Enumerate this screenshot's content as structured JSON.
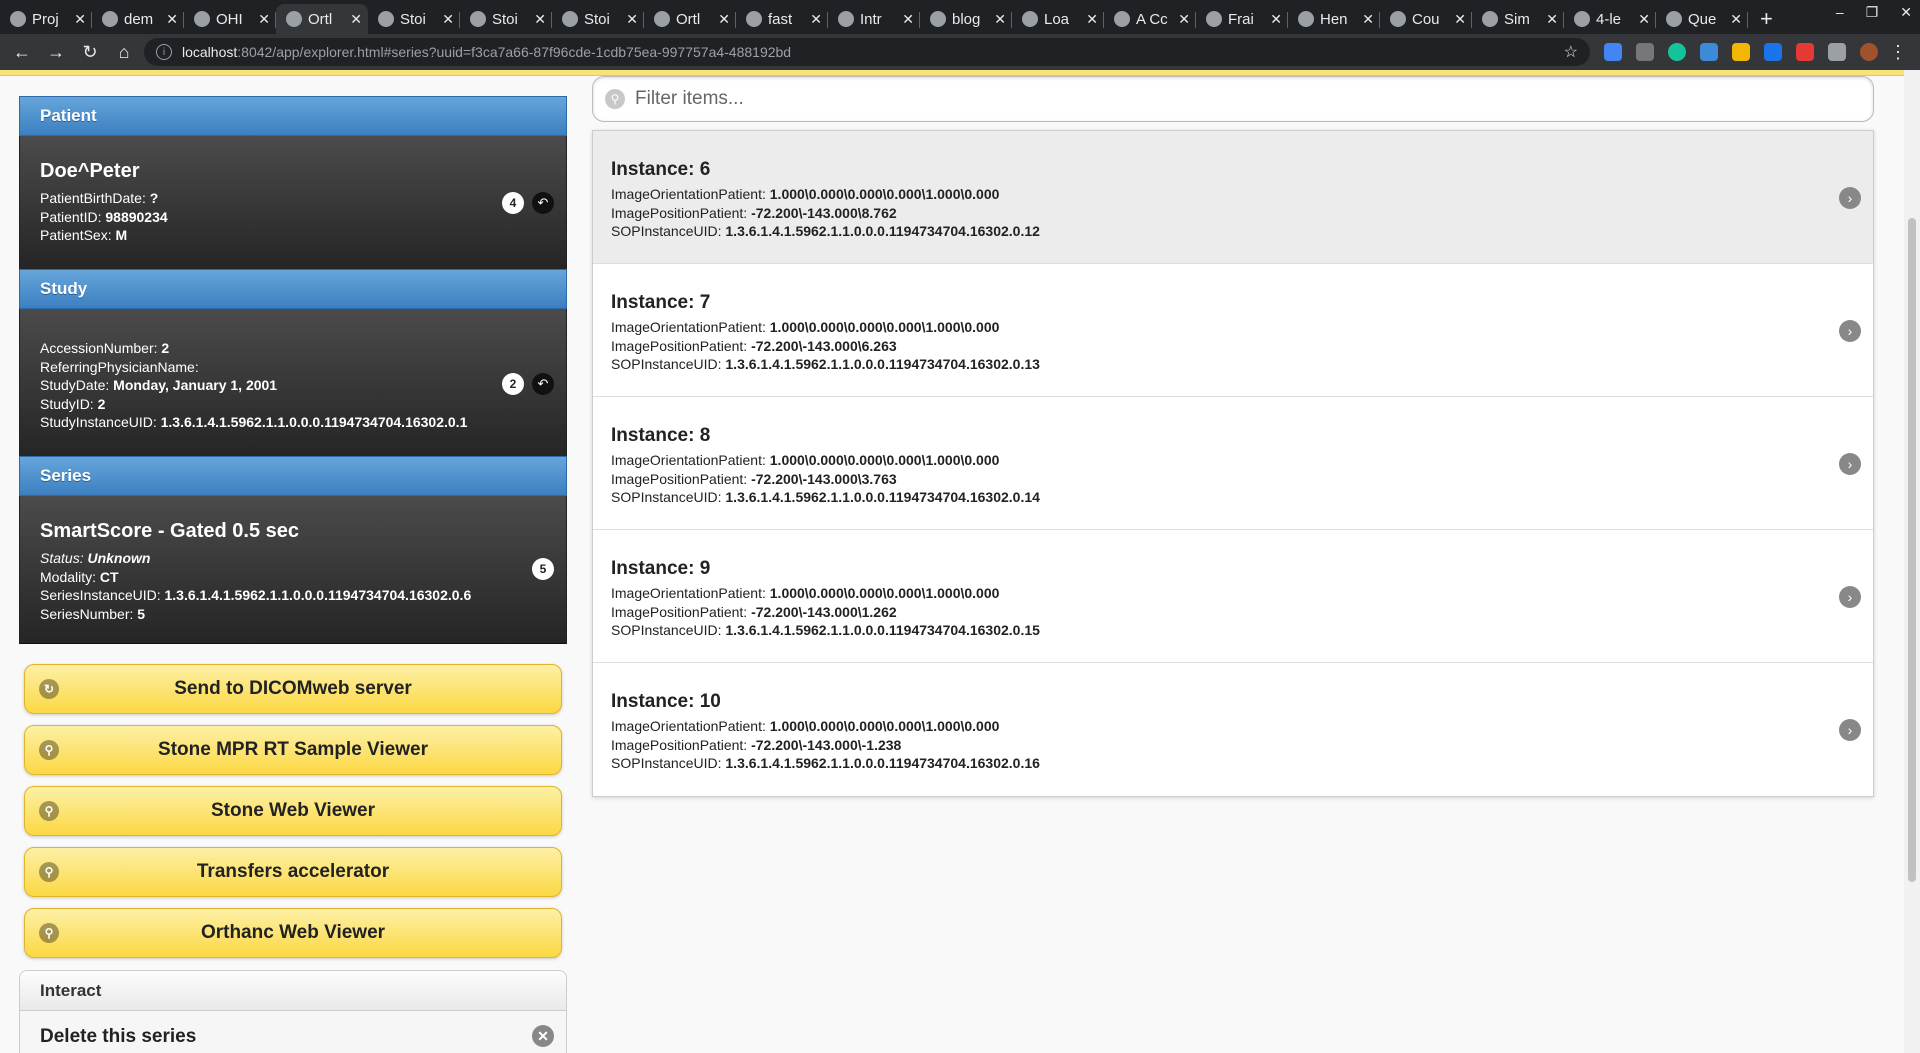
{
  "browser": {
    "tabs": [
      {
        "label": "Proj",
        "active": false
      },
      {
        "label": "dem",
        "active": false
      },
      {
        "label": "OHI",
        "active": false
      },
      {
        "label": "Ortl",
        "active": true
      },
      {
        "label": "Stoi",
        "active": false
      },
      {
        "label": "Stoi",
        "active": false
      },
      {
        "label": "Stoi",
        "active": false
      },
      {
        "label": "Ortl",
        "active": false
      },
      {
        "label": "fast",
        "active": false
      },
      {
        "label": "Intr",
        "active": false
      },
      {
        "label": "blog",
        "active": false
      },
      {
        "label": "Loa",
        "active": false
      },
      {
        "label": "A Cc",
        "active": false
      },
      {
        "label": "Frai",
        "active": false
      },
      {
        "label": "Hen",
        "active": false
      },
      {
        "label": "Cou",
        "active": false
      },
      {
        "label": "Sim",
        "active": false
      },
      {
        "label": "4-le",
        "active": false
      },
      {
        "label": "Que",
        "active": false
      }
    ],
    "url_host": "localhost",
    "url_path": ":8042/app/explorer.html#series?uuid=f3ca7a66-87f96cde-1cdb75ea-997757a4-488192bd"
  },
  "patient": {
    "header": "Patient",
    "name": "Doe^Peter",
    "birth_date_label": "PatientBirthDate:",
    "birth_date": "?",
    "id_label": "PatientID:",
    "id": "98890234",
    "sex_label": "PatientSex:",
    "sex": "M",
    "count": "4"
  },
  "study": {
    "header": "Study",
    "accession_label": "AccessionNumber:",
    "accession": "2",
    "physician_label": "ReferringPhysicianName:",
    "physician": "",
    "date_label": "StudyDate:",
    "date": "Monday, January 1, 2001",
    "study_id_label": "StudyID:",
    "study_id": "2",
    "uid_label": "StudyInstanceUID:",
    "uid": "1.3.6.1.4.1.5962.1.1.0.0.0.1194734704.16302.0.1",
    "count": "2"
  },
  "series": {
    "header": "Series",
    "name": "SmartScore - Gated 0.5 sec",
    "status_label": "Status:",
    "status": "Unknown",
    "modality_label": "Modality:",
    "modality": "CT",
    "uid_label": "SeriesInstanceUID:",
    "uid": "1.3.6.1.4.1.5962.1.1.0.0.0.1194734704.16302.0.6",
    "number_label": "SeriesNumber:",
    "number": "5",
    "count": "5"
  },
  "actions": [
    {
      "label": "Send to DICOMweb server",
      "icon": "refresh-icon"
    },
    {
      "label": "Stone MPR RT Sample Viewer",
      "icon": "search-icon"
    },
    {
      "label": "Stone Web Viewer",
      "icon": "search-icon"
    },
    {
      "label": "Transfers accelerator",
      "icon": "search-icon"
    },
    {
      "label": "Orthanc Web Viewer",
      "icon": "search-icon"
    }
  ],
  "interact": {
    "header": "Interact",
    "delete_label": "Delete this series"
  },
  "filter": {
    "placeholder": "Filter items..."
  },
  "instances": [
    {
      "title": "Instance: 6",
      "orientation": "1.000\\0.000\\0.000\\0.000\\1.000\\0.000",
      "position": "-72.200\\-143.000\\8.762",
      "sop": "1.3.6.1.4.1.5962.1.1.0.0.0.1194734704.16302.0.12"
    },
    {
      "title": "Instance: 7",
      "orientation": "1.000\\0.000\\0.000\\0.000\\1.000\\0.000",
      "position": "-72.200\\-143.000\\6.263",
      "sop": "1.3.6.1.4.1.5962.1.1.0.0.0.1194734704.16302.0.13"
    },
    {
      "title": "Instance: 8",
      "orientation": "1.000\\0.000\\0.000\\0.000\\1.000\\0.000",
      "position": "-72.200\\-143.000\\3.763",
      "sop": "1.3.6.1.4.1.5962.1.1.0.0.0.1194734704.16302.0.14"
    },
    {
      "title": "Instance: 9",
      "orientation": "1.000\\0.000\\0.000\\0.000\\1.000\\0.000",
      "position": "-72.200\\-143.000\\1.262",
      "sop": "1.3.6.1.4.1.5962.1.1.0.0.0.1194734704.16302.0.15"
    },
    {
      "title": "Instance: 10",
      "orientation": "1.000\\0.000\\0.000\\0.000\\1.000\\0.000",
      "position": "-72.200\\-143.000\\-1.238",
      "sop": "1.3.6.1.4.1.5962.1.1.0.0.0.1194734704.16302.0.16"
    }
  ],
  "labels": {
    "orientation": "ImageOrientationPatient:",
    "position": "ImagePositionPatient:",
    "sop": "SOPInstanceUID:"
  }
}
